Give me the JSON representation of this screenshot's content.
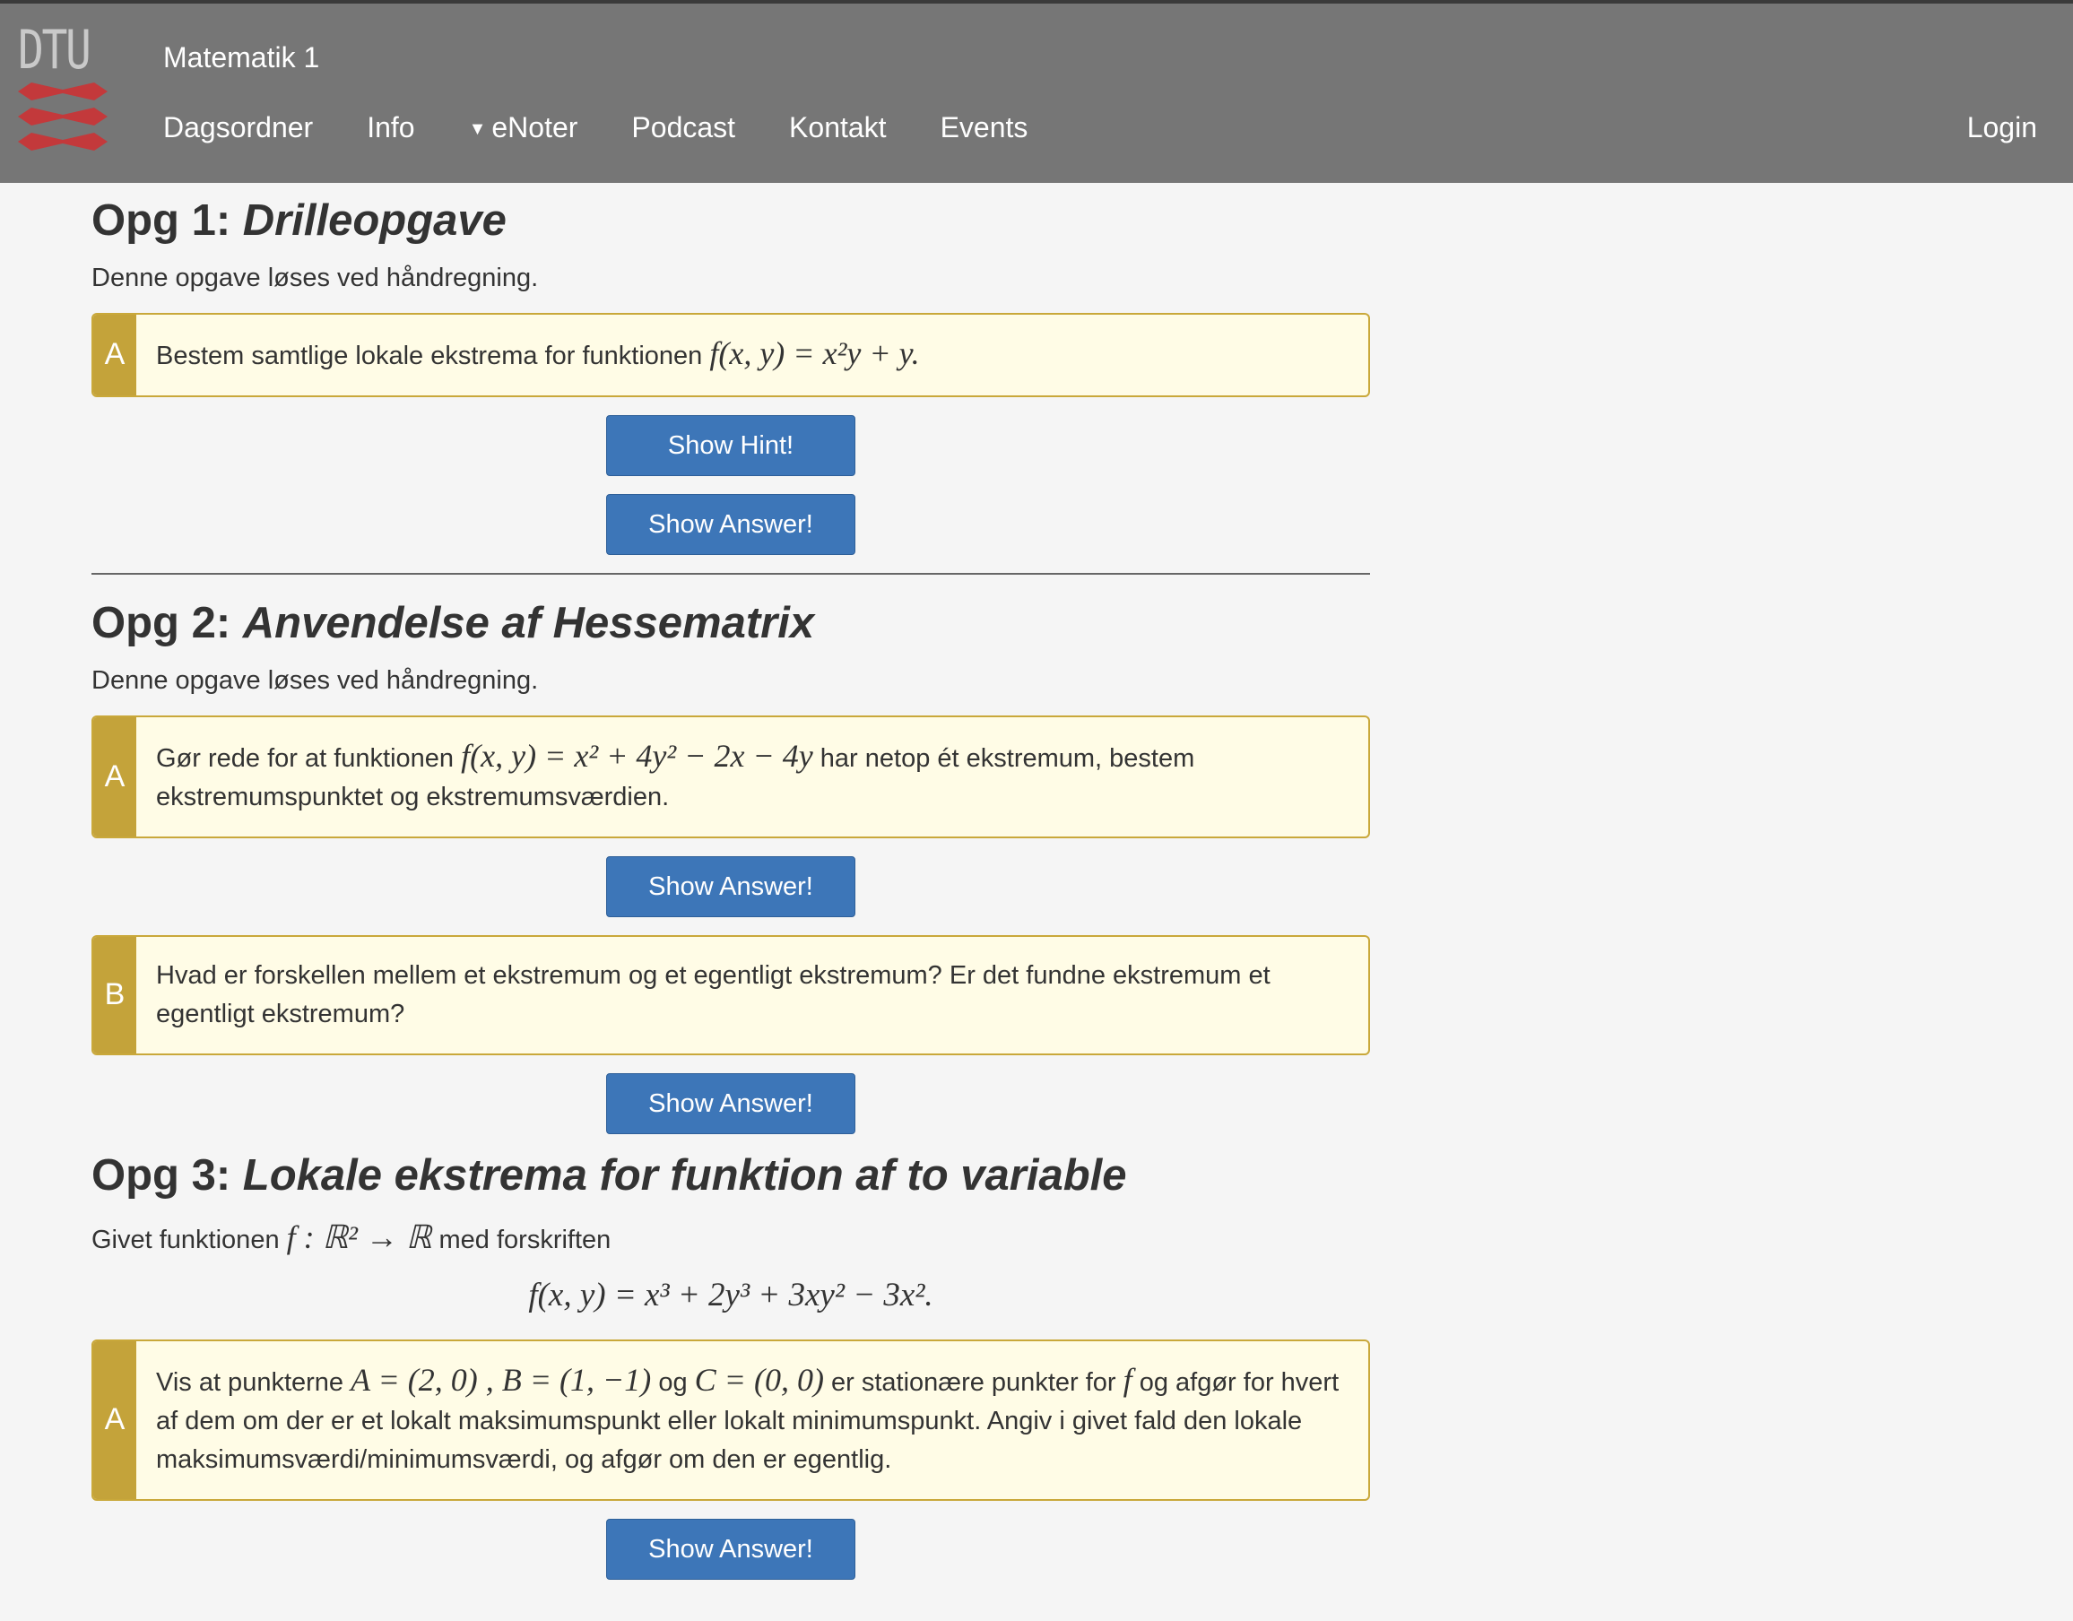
{
  "nav": {
    "logo_text": "DTU",
    "brand": "Matematik 1",
    "items": [
      "Dagsordner",
      "Info",
      "eNoter",
      "Podcast",
      "Kontakt",
      "Events"
    ],
    "login": "Login"
  },
  "opg1": {
    "heading_prefix": "Opg 1:",
    "heading_title": "Drilleopgave",
    "intro": "Denne opgave løses ved håndregning.",
    "a_label": "A",
    "a_text": "Bestem samtlige lokale ekstrema for funktionen",
    "a_math": "f(x, y) = x²y + y.",
    "hint_button": "Show Hint!",
    "answer_button": "Show Answer!"
  },
  "opg2": {
    "heading_prefix": "Opg 2:",
    "heading_title": "Anvendelse af Hessematrix",
    "intro": "Denne opgave løses ved håndregning.",
    "a_label": "A",
    "a_text_before": "Gør rede for at funktionen",
    "a_math": "f(x, y) = x² + 4y² − 2x − 4y",
    "a_text_after": "har netop ét ekstremum, bestem ekstremumspunktet og ekstremumsværdien.",
    "a_answer_button": "Show Answer!",
    "b_label": "B",
    "b_text": "Hvad er forskellen mellem et ekstremum og et egentligt ekstremum? Er det fundne ekstremum et egentligt ekstremum?",
    "b_answer_button": "Show Answer!"
  },
  "opg3": {
    "heading_prefix": "Opg 3:",
    "heading_title": "Lokale ekstrema for funktion af to variable",
    "intro_before": "Givet funktionen",
    "intro_math": "f : ℝ² → ℝ",
    "intro_after": "med forskriften",
    "display_math": "f(x, y) = x³ + 2y³ + 3xy² − 3x².",
    "a_label": "A",
    "a_text_1": "Vis at punkterne",
    "a_math_1": "A = (2, 0) , B = (1, −1)",
    "a_text_2": "og",
    "a_math_2": "C = (0, 0)",
    "a_text_3": "er stationære punkter for",
    "a_math_3": "f",
    "a_text_4": "og afgør for hvert af dem om der er et lokalt maksimumspunkt eller lokalt minimumspunkt. Angiv i givet fald den lokale maksimumsværdi/minimumsværdi, og afgør om den er egentlig.",
    "a_answer_button": "Show Answer!"
  }
}
